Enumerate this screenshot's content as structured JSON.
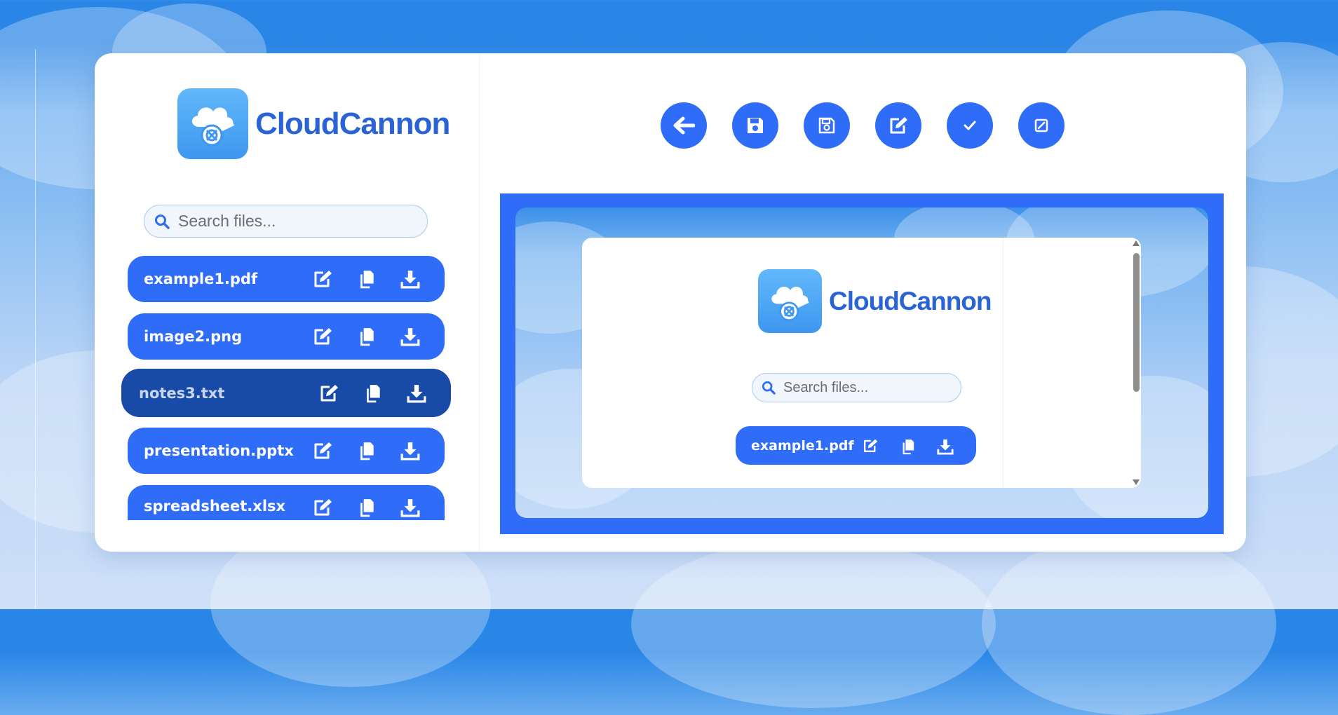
{
  "app": {
    "name": "CloudCannon",
    "brand_color": "#2f6cf7",
    "active_row_color": "#184aa8",
    "logo_text_color": "#2a63d6"
  },
  "sidebar": {
    "search": {
      "placeholder": "Search files...",
      "value": "",
      "icon": "search-icon"
    },
    "files": [
      {
        "name": "example1.pdf",
        "active": false
      },
      {
        "name": "image2.png",
        "active": false
      },
      {
        "name": "notes3.txt",
        "active": true
      },
      {
        "name": "presentation.pptx",
        "active": false
      },
      {
        "name": "spreadsheet.xlsx",
        "active": false
      }
    ],
    "row_actions": [
      "edit-icon",
      "copy-icon",
      "download-icon"
    ]
  },
  "toolbar": {
    "buttons": [
      {
        "name": "back-button",
        "icon": "arrow-left-icon"
      },
      {
        "name": "save-button",
        "icon": "floppy-disk-icon"
      },
      {
        "name": "save-as-button",
        "icon": "floppy-disk-outline-icon"
      },
      {
        "name": "edit-button",
        "icon": "pencil-square-icon"
      },
      {
        "name": "confirm-button",
        "icon": "check-icon"
      },
      {
        "name": "rename-button",
        "icon": "square-slash-icon"
      }
    ]
  },
  "preview": {
    "app_name": "CloudCannon",
    "search_placeholder": "Search files...",
    "first_file": "example1.pdf"
  }
}
